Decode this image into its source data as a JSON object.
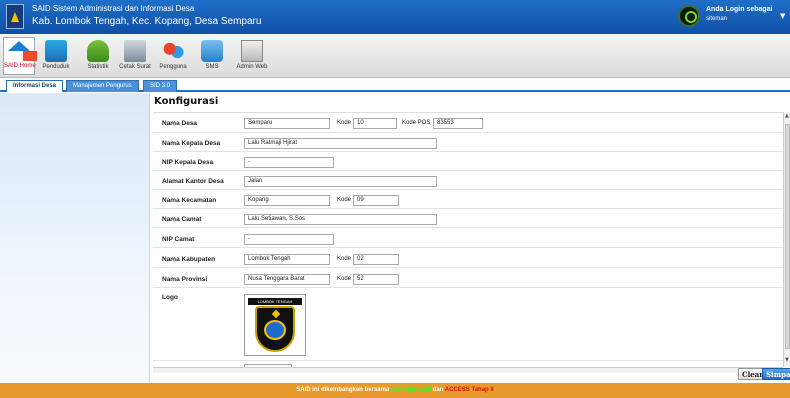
{
  "header": {
    "title": "SAID Sistem Administrasi dan Informasi Desa",
    "subtitle": "Kab. Lombok Tengah, Kec. Kopang, Desa Semparu",
    "login_label": "Anda Login sebagai",
    "username": "siteman"
  },
  "toolbar": {
    "items": [
      {
        "label": "SAID Home",
        "icon": "home-icon"
      },
      {
        "label": "Penduduk",
        "icon": "people-icon"
      },
      {
        "label": "Statistik",
        "icon": "chart-icon"
      },
      {
        "label": "Cetak Surat",
        "icon": "print-icon"
      },
      {
        "label": "Pengguna",
        "icon": "users-icon"
      },
      {
        "label": "SMS",
        "icon": "sms-icon"
      },
      {
        "label": "Admin Web",
        "icon": "admin-web-icon"
      }
    ]
  },
  "tabs": [
    {
      "label": "Informasi Desa",
      "active": true
    },
    {
      "label": "Manajemen Pengurus",
      "active": false
    },
    {
      "label": "SID 3.0",
      "active": false
    }
  ],
  "page": {
    "title": "Konfigurasi"
  },
  "form": {
    "nama_desa": {
      "label": "Nama Desa",
      "value": "Semparu",
      "kode_label": "Kode",
      "kode": "10",
      "pos_label": "Kode POS",
      "pos": "83553"
    },
    "kepala_desa": {
      "label": "Nama Kepala Desa",
      "value": "Lalu Ratmaji Hjirat"
    },
    "nip_kepala": {
      "label": "NIP Kepala Desa",
      "value": "-"
    },
    "alamat": {
      "label": "Alamat Kantor Desa",
      "value": "Jalan"
    },
    "kecamatan": {
      "label": "Nama Kecamatan",
      "value": "Kopang",
      "kode_label": "Kode",
      "kode": "09"
    },
    "camat": {
      "label": "Nama Camat",
      "value": "Lalu Setiawan, S.Sos"
    },
    "nip_camat": {
      "label": "NIP Camat",
      "value": "-"
    },
    "kabupaten": {
      "label": "Nama Kabupaten",
      "value": "Lombok Tengah",
      "kode_label": "Kode",
      "kode": "02"
    },
    "provinsi": {
      "label": "Nama Provinsi",
      "value": "Nusa Tenggara Barat",
      "kode_label": "Kode",
      "kode": "52"
    },
    "logo": {
      "label": "Logo",
      "banner": "LOMBOK TENGAH"
    }
  },
  "buttons": {
    "clear": "Clear",
    "save": "Simpan"
  },
  "footer": {
    "prefix": "SAID ini dikembangkan bersama",
    "link1": "Combine.or.id",
    "middle": "dan",
    "link2": "ACCESS Tahap II"
  },
  "colors": {
    "header": "#1f6fc9",
    "footer": "#e89a2c",
    "accent_green": "#2cff2c",
    "accent_red": "#e01010"
  }
}
